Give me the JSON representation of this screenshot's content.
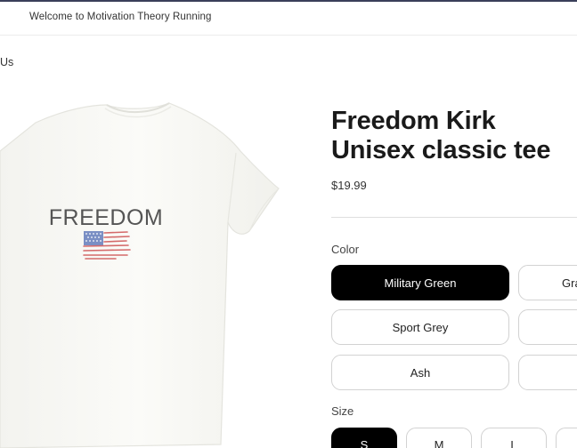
{
  "header": {
    "welcome_text": "Welcome to Motivation Theory Running"
  },
  "breadcrumb": {
    "text": "Us"
  },
  "product": {
    "shirt_print_text": "FREEDOM",
    "title": "Freedom Kirk Unisex classic tee",
    "price": "$19.99"
  },
  "colors": {
    "label": "Color",
    "options": [
      {
        "label": "Military Green",
        "selected": true
      },
      {
        "label": "Gra",
        "selected": false
      },
      {
        "label": "Sport Grey",
        "selected": false
      },
      {
        "label": "",
        "selected": false
      },
      {
        "label": "Ash",
        "selected": false
      },
      {
        "label": "",
        "selected": false
      }
    ]
  },
  "sizes": {
    "label": "Size",
    "options": [
      {
        "label": "S",
        "selected": true
      },
      {
        "label": "M",
        "selected": false
      },
      {
        "label": "L",
        "selected": false
      },
      {
        "label": "",
        "selected": false
      }
    ]
  },
  "theme": {
    "accent": "#000000",
    "border": "#d2d2d2",
    "topbar_line": "#3a3f5a"
  }
}
